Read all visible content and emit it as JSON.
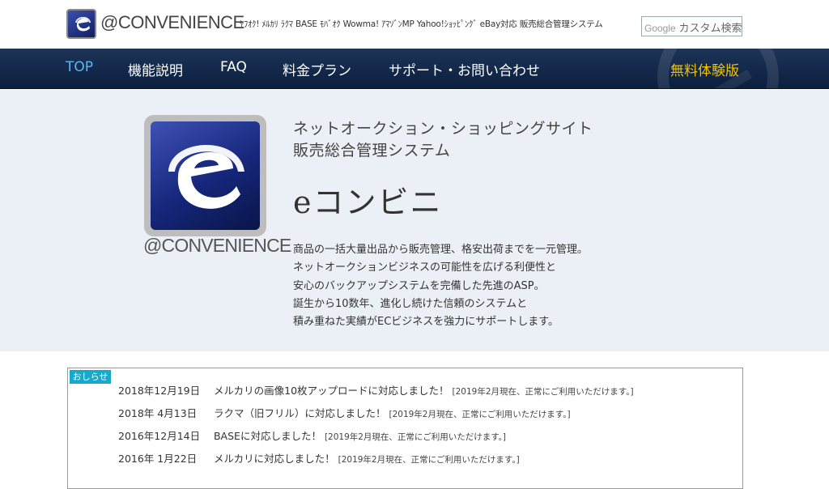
{
  "header": {
    "logo_text": "@CONVENIENCE",
    "tagline": "ﾔﾌｵｸ! ﾒﾙｶﾘ ﾗｸﾏ BASE ﾓﾊﾞｵｸ Wowma! ｱﾏｿﾞﾝMP Yahoo!ｼｮｯﾋﾟﾝｸﾞ eBay対応 販売総合管理システム",
    "search_brand": "Google",
    "search_placeholder": "カスタム検索"
  },
  "nav": {
    "items": [
      {
        "label": "TOP",
        "active": true
      },
      {
        "label": "機能説明"
      },
      {
        "label": "FAQ"
      },
      {
        "label": "料金プラン"
      },
      {
        "label": "サポート・お問い合わせ"
      }
    ],
    "trial": "無料体験版"
  },
  "hero": {
    "title_line1": "ネットオークション・ショッピングサイト",
    "title_line2": "販売総合管理システム",
    "product_name": "eコンビニ",
    "logo_caption": "@CONVENIENCE",
    "description": [
      "商品の一括大量出品から販売管理、格安出荷までを一元管理。",
      "ネットオークションビジネスの可能性を広げる利便性と",
      "安心のバックアップシステムを完備した先進のASP。",
      "誕生から10数年、進化し続けた信頼のシステムと",
      "積み重ねた実績がECビジネスを強力にサポートします。"
    ]
  },
  "news": {
    "badge": "おしらせ",
    "items": [
      {
        "date": "2018年12月19日",
        "text": "メルカリの画像10枚アップロードに対応しました！",
        "note": "[2019年2月現在、正常にご利用いただけます。]"
      },
      {
        "date": "2018年 4月13日",
        "text": "ラクマ（旧フリル）に対応しました！",
        "note": "[2019年2月現在、正常にご利用いただけます。]"
      },
      {
        "date": "2016年12月14日",
        "text": "BASEに対応しました！",
        "note": "[2019年2月現在、正常にご利用いただけます。]"
      },
      {
        "date": "2016年 1月22日",
        "text": "メルカリに対応しました！",
        "note": "[2019年2月現在、正常にご利用いただけます。]"
      }
    ]
  },
  "colors": {
    "nav_bg": "#0b1f3e",
    "nav_active": "#5fb7f0",
    "trial": "#f2c300",
    "hero_bg": "#eaf0f6",
    "badge": "#16a9cb"
  }
}
